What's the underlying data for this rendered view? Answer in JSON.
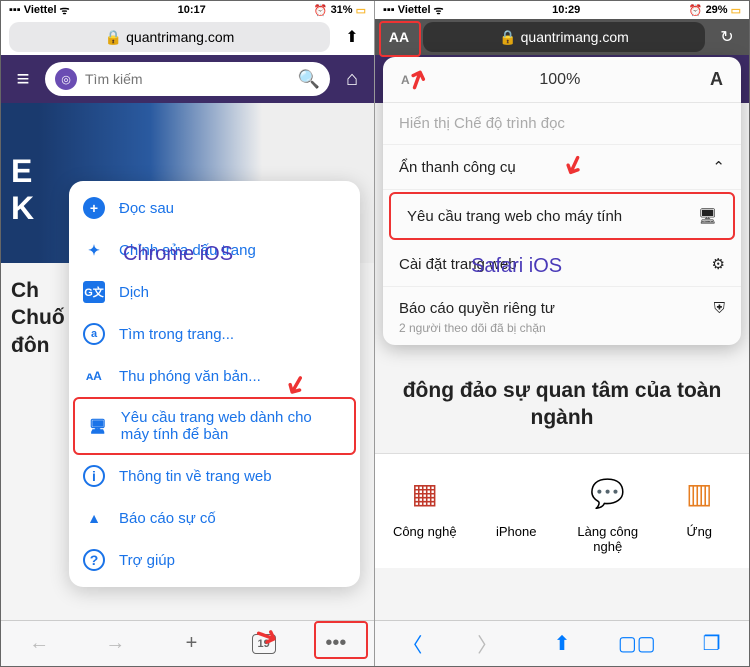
{
  "left": {
    "status": {
      "carrier": "Viettel",
      "time": "10:17",
      "battery": "31%"
    },
    "url": "quantrimang.com",
    "search_placeholder": "Tìm kiếm",
    "hero_text": "E\nK",
    "headline": "Ch\nChuố\nđôn",
    "menu": {
      "read_later": "Đọc sau",
      "edit_bookmark": "Chỉnh sửa dấu trang",
      "translate": "Dịch",
      "find": "Tìm trong trang...",
      "zoom_text": "Thu phóng văn bản...",
      "desktop": "Yêu cầu trang web dành cho máy tính để bàn",
      "site_info": "Thông tin về trang web",
      "report": "Báo cáo sự cố",
      "help": "Trợ giúp"
    },
    "overlay_label": "Chrome iOS",
    "tab_count": "19"
  },
  "right": {
    "status": {
      "carrier": "Viettel",
      "time": "10:29",
      "battery": "29%"
    },
    "url": "quantrimang.com",
    "aa": "AA",
    "popup": {
      "zoom": "100%",
      "a_small": "A",
      "a_large": "A",
      "reader": "Hiển thị Chế độ trình đọc",
      "hide_toolbar": "Ẩn thanh công cụ",
      "desktop": "Yêu cầu trang web cho máy tính",
      "site_settings": "Cài đặt trang web",
      "privacy_report": "Báo cáo quyền riêng tư",
      "privacy_sub": "2 người theo dõi đã bị chặn"
    },
    "headline": "đông đảo sự quan tâm của toàn ngành",
    "cats": {
      "tech": "Công nghệ",
      "iphone": "iPhone",
      "village": "Làng công nghệ",
      "app": "Ứng"
    },
    "overlay_label": "Safari iOS"
  }
}
